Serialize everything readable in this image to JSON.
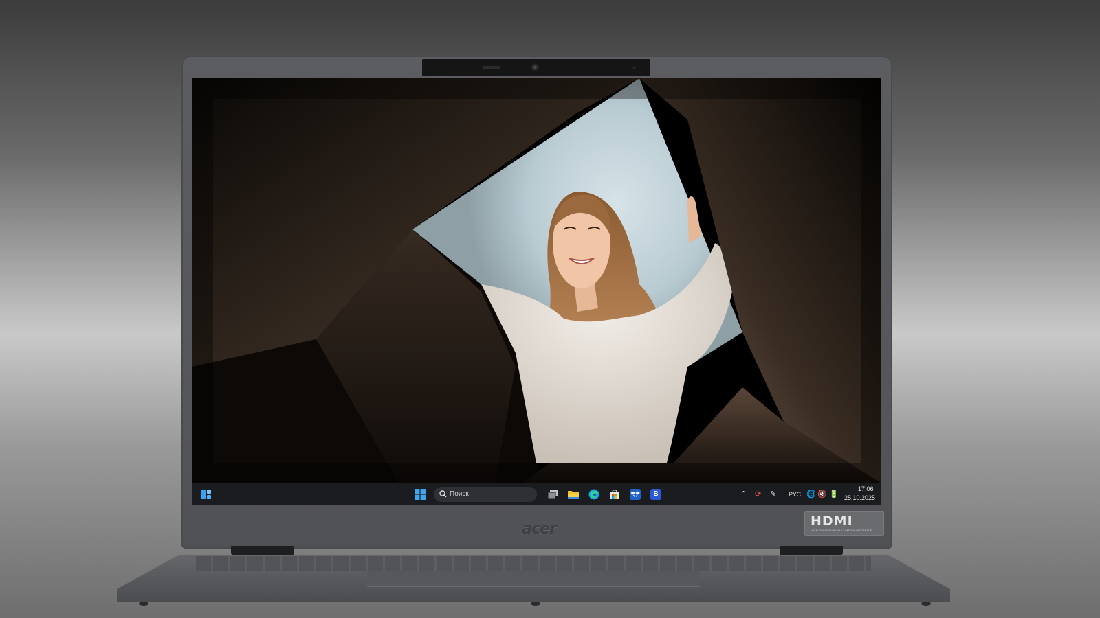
{
  "taskbar": {
    "search_label": "Поиск",
    "language": "РУС",
    "time": "17:06",
    "date": "25.10.2025",
    "app_letter": "B"
  },
  "bezel": {
    "brand_logo": "acer",
    "port_badge": "HDMI",
    "port_badge_sub": "HIGH-DEFINITION MULTIMEDIA INTERFACE"
  },
  "icons": {
    "widgets": "widgets-icon",
    "start": "windows-start-icon",
    "search": "search-icon",
    "task_view": "task-view-icon",
    "explorer": "file-explorer-icon",
    "edge": "edge-browser-icon",
    "store": "microsoft-store-icon",
    "dropbox": "dropbox-icon",
    "tray": [
      "chevron-up-icon",
      "sync-icon",
      "pen-icon",
      "network-icon",
      "volume-muted-icon",
      "battery-icon"
    ]
  },
  "colors": {
    "taskbar_bg": "#1b1c20",
    "accent_blue": "#3aa0f0",
    "chassis": "#55565a"
  }
}
